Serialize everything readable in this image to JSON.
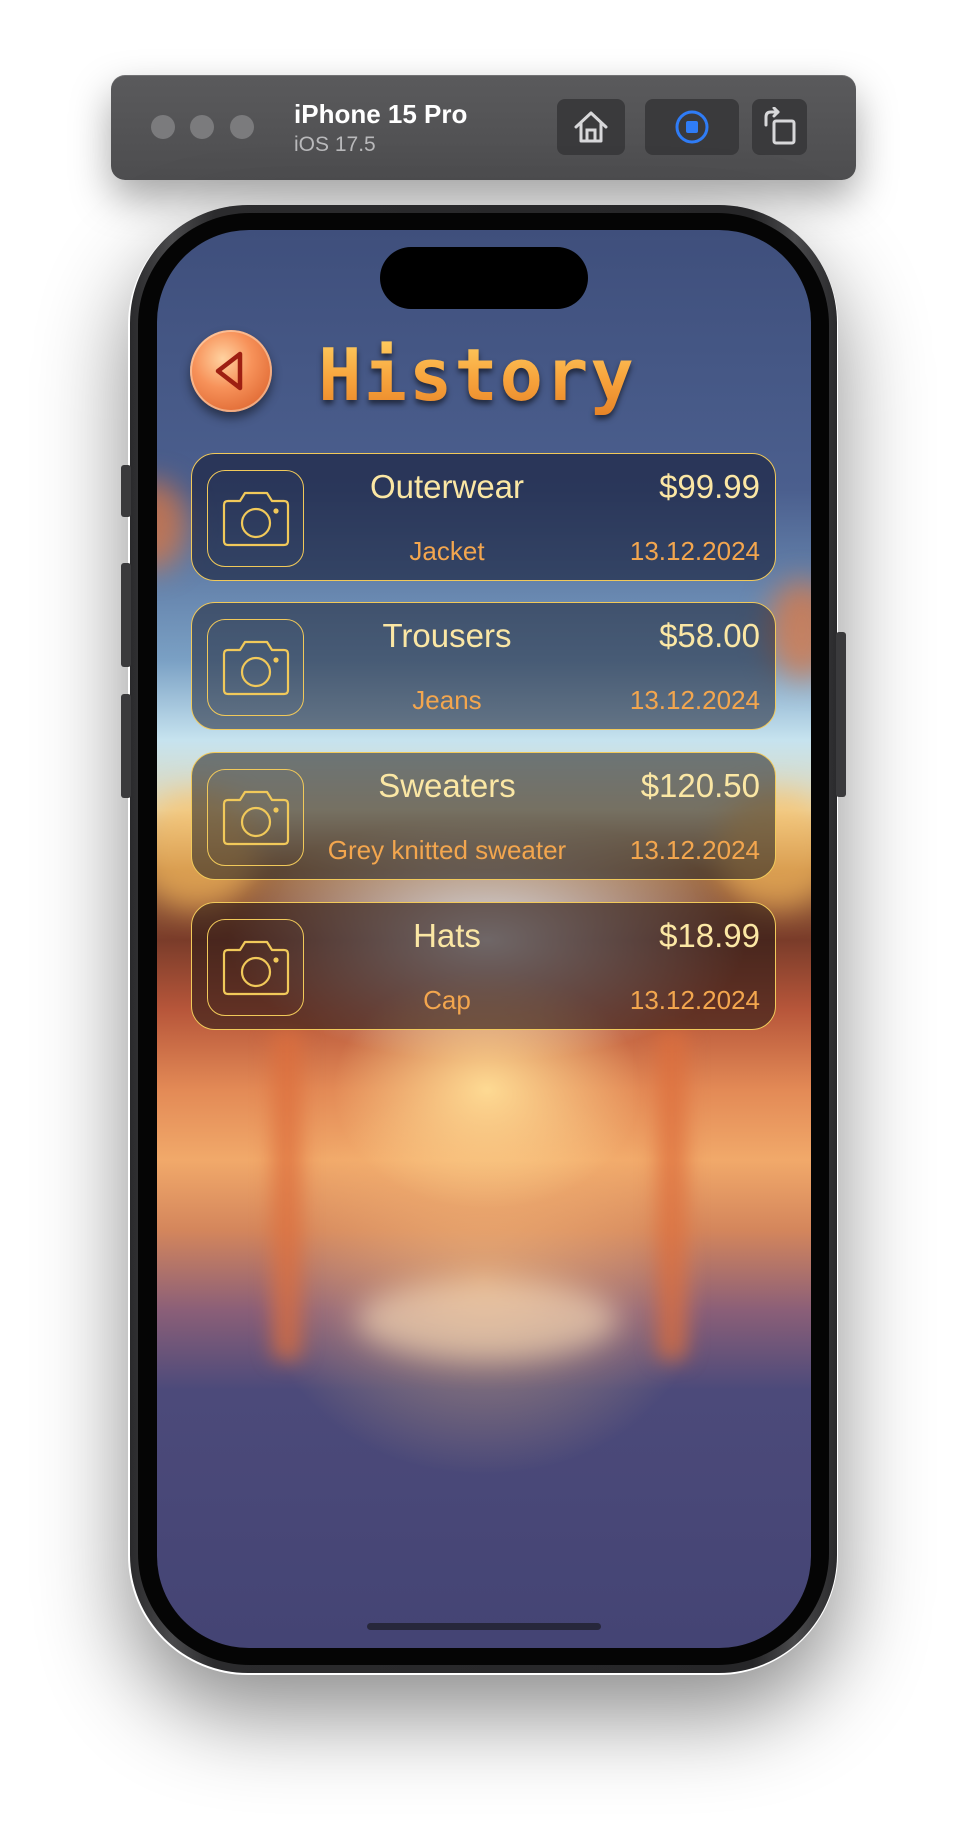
{
  "simulator": {
    "device_name": "iPhone 15 Pro",
    "os_version": "iOS 17.5",
    "buttons": {
      "home_icon": "home-icon",
      "record_icon": "record-icon",
      "rotate_icon": "rotate-icon"
    },
    "accent_color": "#2f7cf6"
  },
  "app": {
    "title": "History",
    "back_icon": "back-triangle-icon",
    "title_color": "#f6a53d",
    "card_border_color": "#f1c95a"
  },
  "history": {
    "items": [
      {
        "category": "Outerwear",
        "price": "$99.99",
        "name": "Jacket",
        "date": "13.12.2024",
        "icon": "camera-icon"
      },
      {
        "category": "Trousers",
        "price": "$58.00",
        "name": "Jeans",
        "date": "13.12.2024",
        "icon": "camera-icon"
      },
      {
        "category": "Sweaters",
        "price": "$120.50",
        "name": "Grey knitted sweater",
        "date": "13.12.2024",
        "icon": "camera-icon"
      },
      {
        "category": "Hats",
        "price": "$18.99",
        "name": "Cap",
        "date": "13.12.2024",
        "icon": "camera-icon"
      }
    ]
  }
}
